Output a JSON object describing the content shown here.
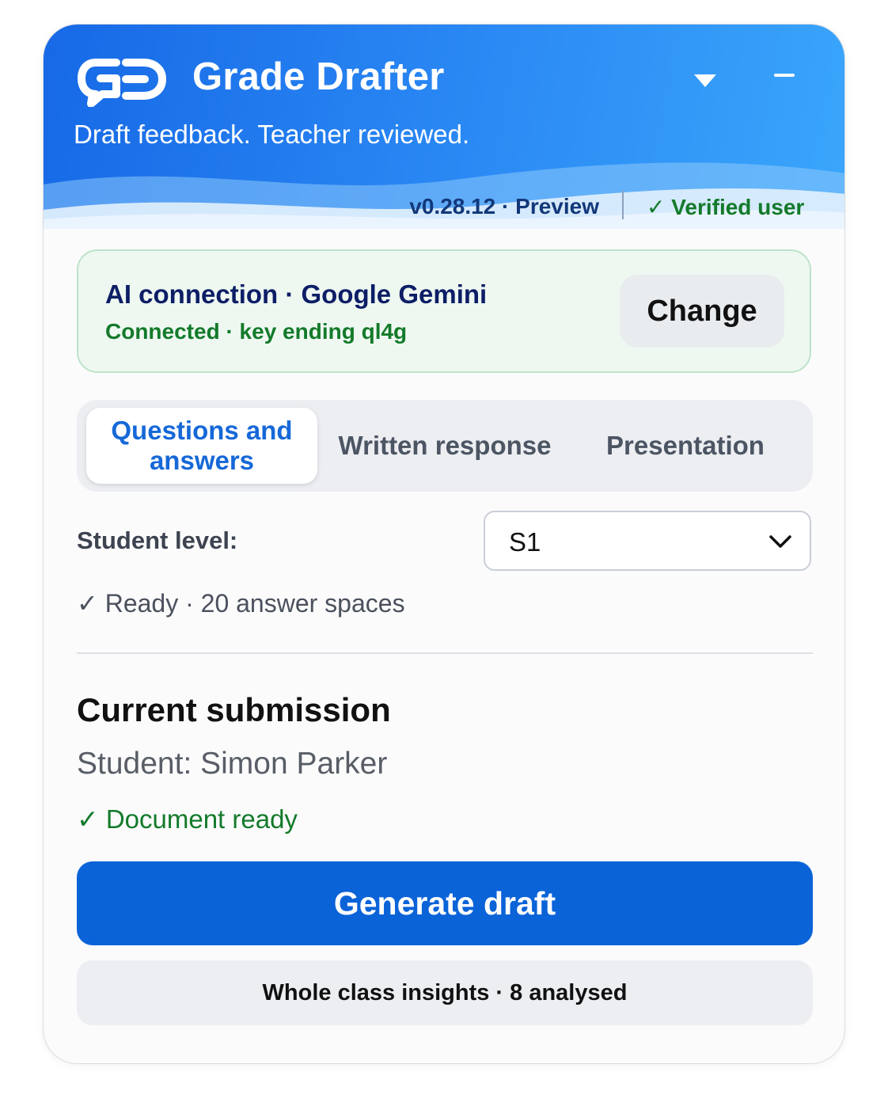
{
  "header": {
    "app_title": "Grade Drafter",
    "tagline": "Draft feedback. Teacher reviewed.",
    "version": "v0.28.12 · Preview",
    "verified": "✓ Verified user",
    "brand_color": "#1769e6"
  },
  "ai_connection": {
    "title": "AI connection · Google Gemini",
    "status": "Connected · key ending ql4g",
    "change_label": "Change"
  },
  "tabs": [
    {
      "label": "Questions and answers",
      "active": true
    },
    {
      "label": "Written response",
      "active": false
    },
    {
      "label": "Presentation",
      "active": false
    }
  ],
  "student_level": {
    "label": "Student level:",
    "selected": "S1"
  },
  "ready_status": "✓ Ready · 20 answer spaces",
  "submission": {
    "title": "Current submission",
    "student": "Student: Simon Parker",
    "document_status": "✓ Document ready"
  },
  "actions": {
    "generate_label": "Generate draft",
    "insights_label": "Whole class insights · 8 analysed"
  }
}
